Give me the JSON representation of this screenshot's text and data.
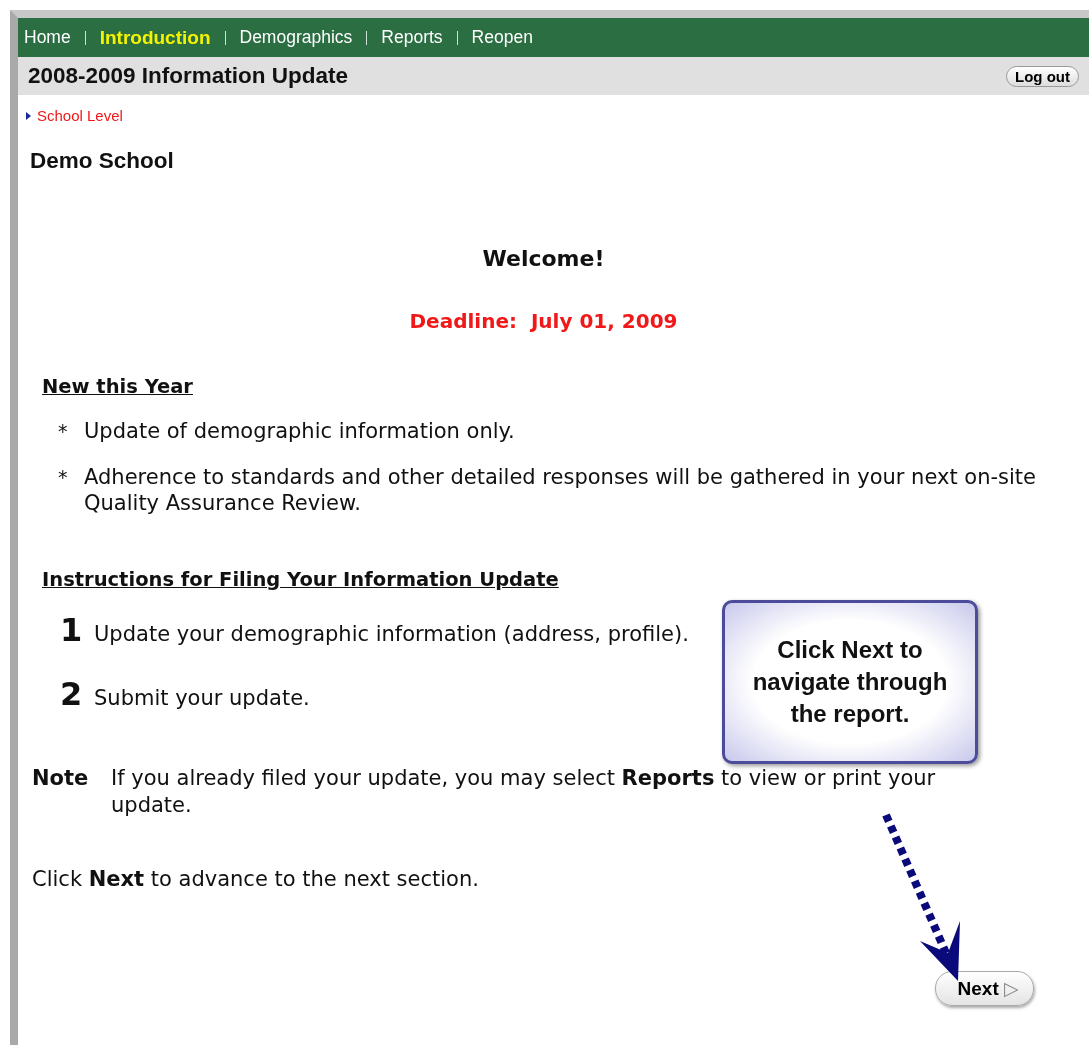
{
  "nav": [
    {
      "label": "Home",
      "selected": false
    },
    {
      "label": "Introduction",
      "selected": true
    },
    {
      "label": "Demographics",
      "selected": false
    },
    {
      "label": "Reports",
      "selected": false
    },
    {
      "label": "Reopen",
      "selected": false
    }
  ],
  "title_bar": {
    "title": "2008-2009 Information Update",
    "logout": "Log out"
  },
  "breadcrumb": "School Level",
  "school": "Demo School",
  "welcome": "Welcome!",
  "deadline": "Deadline:  July 01, 2009",
  "new_section": {
    "heading": "New this Year",
    "bullet": "*",
    "items": [
      "Update of demographic information only.",
      "Adherence to standards and other detailed responses will be gathered in your next on-site Quality Assurance Review."
    ]
  },
  "instructions": {
    "heading": "Instructions for Filing Your Information Update",
    "steps": [
      {
        "number": "1",
        "text": "Update your demographic information (address, profile)."
      },
      {
        "number": "2",
        "text": "Submit your update."
      }
    ]
  },
  "note": {
    "label": "Note",
    "text": "If you already filed your update, you may select **Reports** to view or print your update."
  },
  "advance": "Click **Next** to advance to the next section.",
  "next_button": {
    "label": "Next",
    "arrow": "▷"
  },
  "callout": "Click Next to navigate through the report."
}
